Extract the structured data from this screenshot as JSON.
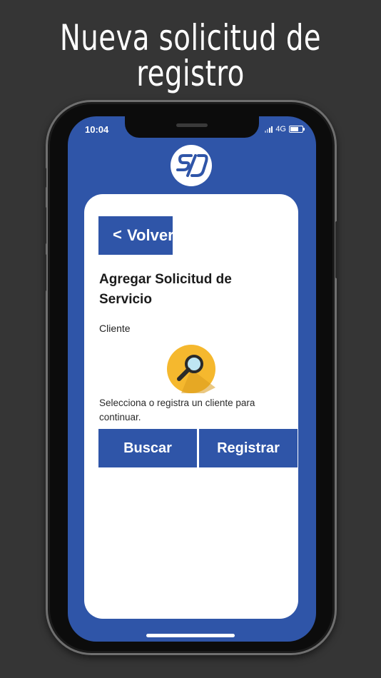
{
  "headline": {
    "line1": "Nueva solicitud de",
    "line2": "registro"
  },
  "status_bar": {
    "time": "10:04",
    "network": "4G"
  },
  "back_button": {
    "chevron": "<",
    "label": "Volver"
  },
  "form": {
    "title": "Agregar Solicitud de Servicio",
    "field_label": "Cliente",
    "icon": "magnifier-icon",
    "hint": "Selecciona o registra un cliente para continuar."
  },
  "actions": {
    "search_label": "Buscar",
    "register_label": "Registrar"
  },
  "colors": {
    "brand_blue": "#2f55a8",
    "icon_yellow": "#f5b82e",
    "background": "#353535"
  }
}
